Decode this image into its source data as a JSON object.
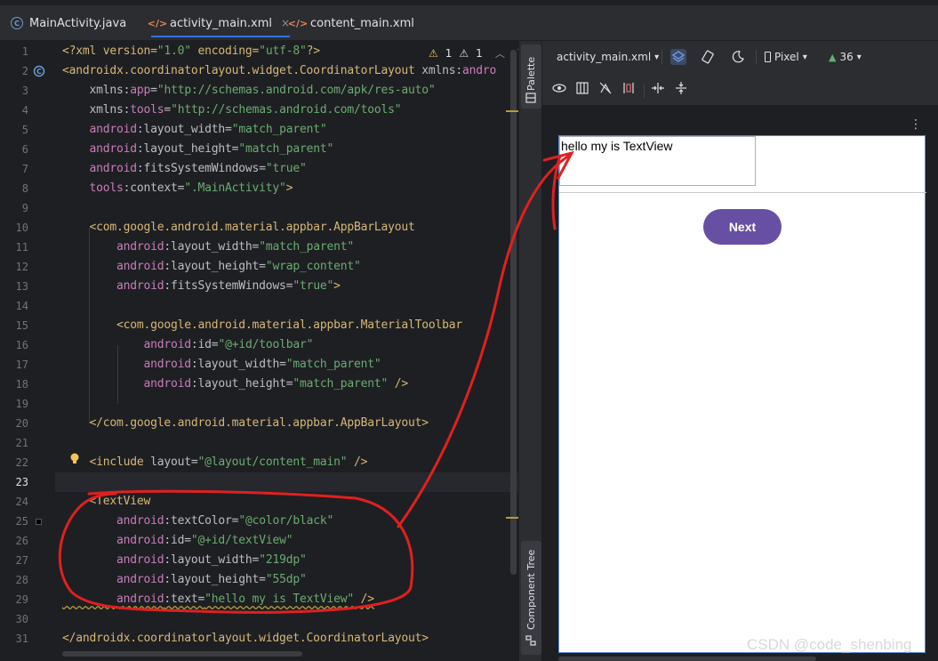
{
  "tabs": [
    {
      "label": "MainActivity.java",
      "icon": "java-class-icon",
      "active": false
    },
    {
      "label": "activity_main.xml",
      "icon": "xml-icon",
      "active": true
    },
    {
      "label": "content_main.xml",
      "icon": "xml-icon",
      "active": false
    }
  ],
  "tab_close": "×",
  "editor": {
    "warnings": {
      "a": "1",
      "b": "1"
    },
    "line_numbers": [
      "1",
      "2",
      "3",
      "4",
      "5",
      "6",
      "7",
      "8",
      "9",
      "10",
      "11",
      "12",
      "13",
      "14",
      "15",
      "16",
      "17",
      "18",
      "19",
      "20",
      "21",
      "22",
      "23",
      "24",
      "25",
      "26",
      "27",
      "28",
      "29",
      "30",
      "31"
    ],
    "lines": {
      "l1a": "<?xml version=",
      "l1b": "\"1.0\"",
      "l1c": " encoding=",
      "l1d": "\"utf-8\"",
      "l1e": "?>",
      "l2a": "<androidx.coordinatorlayout.widget.CoordinatorLayout",
      "l2b": " xmlns:",
      "l2c": "andro",
      "l3a": "    xmlns:",
      "l3b": "app",
      "l3c": "=",
      "l3d": "\"http://schemas.android.com/apk/res-auto\"",
      "l4a": "    xmlns:",
      "l4b": "tools",
      "l4c": "=",
      "l4d": "\"http://schemas.android.com/tools\"",
      "l5a": "    android",
      "l5b": ":layout_width=",
      "l5c": "\"match_parent\"",
      "l6a": "    android",
      "l6b": ":layout_height=",
      "l6c": "\"match_parent\"",
      "l7a": "    android",
      "l7b": ":fitsSystemWindows=",
      "l7c": "\"true\"",
      "l8a": "    tools",
      "l8b": ":context=",
      "l8c": "\".MainActivity\"",
      "l8d": ">",
      "l10": "    <com.google.android.material.appbar.AppBarLayout",
      "l11a": "        android",
      "l11b": ":layout_width=",
      "l11c": "\"match_parent\"",
      "l12a": "        android",
      "l12b": ":layout_height=",
      "l12c": "\"wrap_content\"",
      "l13a": "        android",
      "l13b": ":fitsSystemWindows=",
      "l13c": "\"true\"",
      "l13d": ">",
      "l15": "        <com.google.android.material.appbar.MaterialToolbar",
      "l16a": "            android",
      "l16b": ":id=",
      "l16c": "\"@+id/toolbar\"",
      "l17a": "            android",
      "l17b": ":layout_width=",
      "l17c": "\"match_parent\"",
      "l18a": "            android",
      "l18b": ":layout_height=",
      "l18c": "\"match_parent\"",
      "l18d": " />",
      "l20": "    </com.google.android.material.appbar.AppBarLayout>",
      "l22a": "    <include",
      "l22b": " layout=",
      "l22c": "\"@layout/content_main\"",
      "l22d": " />",
      "l24": "    <TextView",
      "l25a": "        android",
      "l25b": ":textColor=",
      "l25c": "\"@color/black\"",
      "l26a": "        android",
      "l26b": ":id=",
      "l26c": "\"@+id/textView\"",
      "l27a": "        android",
      "l27b": ":layout_width=",
      "l27c": "\"219dp\"",
      "l28a": "        android",
      "l28b": ":layout_height=",
      "l28c": "\"55dp\"",
      "l29a": "        android",
      "l29b": ":text=",
      "l29c": "\"hello my is TextView\"",
      "l29d": " />",
      "l31": "</androidx.coordinatorlayout.widget.CoordinatorLayout>"
    }
  },
  "side_strip": {
    "palette": "Palette",
    "component_tree": "Component Tree"
  },
  "design_toolbar": {
    "file": "activity_main.xml",
    "device": "Pixel",
    "api": "36",
    "more": "⋮"
  },
  "preview": {
    "textview_text": "hello my is TextView",
    "button_label": "Next",
    "button_color": "#6750a4"
  },
  "watermark": "CSDN @code_shenbing",
  "accent_color": "#3574f0",
  "annotation_color": "#e02020"
}
